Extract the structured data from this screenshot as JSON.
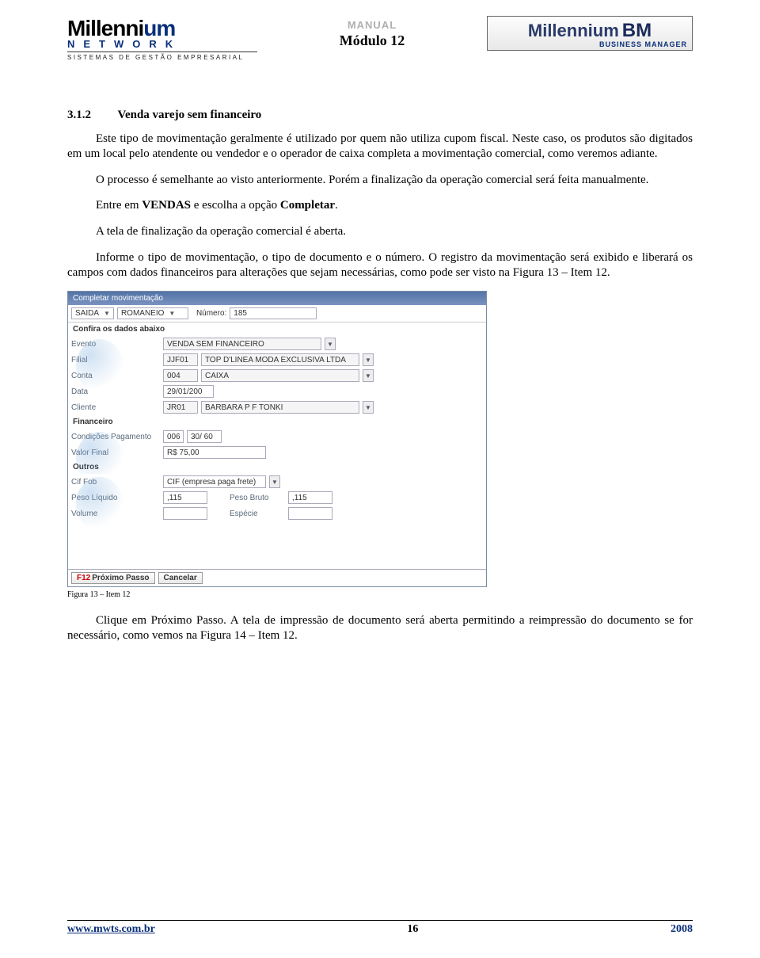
{
  "header": {
    "brand_left": "Millennium",
    "network": "NETWORK",
    "tagline": "SISTEMAS DE GESTÃO EMPRESARIAL",
    "manual": "MANUAL",
    "module": "Módulo 12",
    "brand_right": "Millennium",
    "bm": "BM",
    "bm_sub": "BUSINESS MANAGER"
  },
  "section": {
    "num": "3.1.2",
    "title": "Venda varejo sem financeiro"
  },
  "paragraphs": {
    "p1": "Este tipo de movimentação geralmente é utilizado por quem não utiliza cupom fiscal. Neste caso, os produtos são digitados em um local pelo atendente ou vendedor e o operador de caixa completa a movimentação comercial, como veremos adiante.",
    "p2": "O processo é semelhante ao visto anteriormente. Porém a finalização da operação comercial será feita manualmente.",
    "p3a": "Entre em ",
    "p3b": "VENDAS",
    "p3c": " e escolha a opção ",
    "p3d": "Completar",
    "p3e": ".",
    "p4": "A tela de finalização da operação comercial é aberta.",
    "p5": "Informe o tipo de movimentação, o tipo de documento e o número. O registro da movimentação será exibido e liberará os campos com dados financeiros para alterações que sejam necessárias, como pode ser visto na Figura 13 – Item 12.",
    "p6": "Clique em Próximo Passo. A tela de impressão de documento será aberta permitindo a reimpressão do documento se for necessário, como vemos na Figura 14 – Item 12."
  },
  "screenshot": {
    "title": "Completar movimentação",
    "top": {
      "movtype": "SAIDA",
      "doctype": "ROMANEIO",
      "numlabel": "Número:",
      "numvalue": "185"
    },
    "confira": "Confira os dados abaixo",
    "rows": {
      "evento_lbl": "Evento",
      "evento_val": "VENDA SEM FINANCEIRO",
      "filial_lbl": "Filial",
      "filial_code": "JJF01",
      "filial_val": "TOP D'LINEA MODA EXCLUSIVA LTDA",
      "conta_lbl": "Conta",
      "conta_code": "004",
      "conta_val": "CAIXA",
      "data_lbl": "Data",
      "data_val": "29/01/200",
      "cliente_lbl": "Cliente",
      "cliente_code": "JR01",
      "cliente_val": "BARBARA P F TONKI"
    },
    "financeiro": "Financeiro",
    "fin": {
      "cond_lbl": "Condições Pagamento",
      "cond_code": "006",
      "cond_val": "30/ 60",
      "valor_lbl": "Valor Final",
      "valor_val": "R$ 75,00"
    },
    "outros": "Outros",
    "out": {
      "cif_lbl": "Cif Fob",
      "cif_val": "CIF (empresa paga frete)",
      "pesoliq_lbl": "Peso Líquido",
      "pesoliq_val": ",115",
      "pesobruto_lbl": "Peso Bruto",
      "pesobruto_val": ",115",
      "volume_lbl": "Volume",
      "especie_lbl": "Espécie"
    },
    "buttons": {
      "f12": "F12",
      "proximo": "Próximo Passo",
      "cancelar": "Cancelar"
    }
  },
  "caption": "Figura 13 – Item 12",
  "footer": {
    "url": "www.mwts.com.br",
    "page": "16",
    "year": "2008"
  }
}
